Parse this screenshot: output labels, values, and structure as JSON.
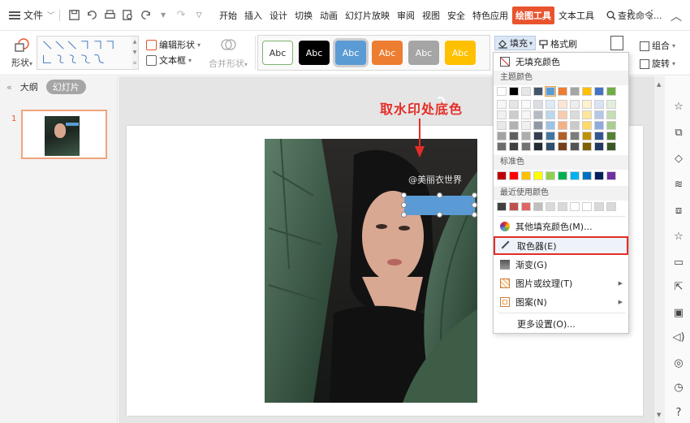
{
  "menubar": {
    "file_label": "文件",
    "tabs": [
      {
        "label": "开始"
      },
      {
        "label": "插入"
      },
      {
        "label": "设计"
      },
      {
        "label": "切换"
      },
      {
        "label": "动画"
      },
      {
        "label": "幻灯片放映"
      },
      {
        "label": "审阅"
      },
      {
        "label": "视图"
      },
      {
        "label": "安全"
      },
      {
        "label": "特色应用"
      },
      {
        "label": "绘图工具",
        "active": true
      },
      {
        "label": "文本工具"
      }
    ],
    "search_label": "查找命令...",
    "icons": [
      "save-icon",
      "undo-icon",
      "print-icon",
      "preview-icon",
      "redo-icon",
      "help-icon",
      "more-icon",
      "collapse-icon"
    ]
  },
  "ribbon": {
    "shape_label": "形状",
    "edit_shape_label": "编辑形状",
    "textbox_label": "文本框",
    "merge_shape_label": "合并形状",
    "style_samples": [
      "Abc",
      "Abc",
      "Abc",
      "Abc",
      "Abc",
      "Abc"
    ],
    "fill_label": "填充",
    "format_brush_label": "格式刷",
    "group_label": "组合",
    "rotate_label": "旋转"
  },
  "left_panel": {
    "outline_tab": "大纲",
    "slides_tab": "幻灯片",
    "slide_number": "1"
  },
  "canvas": {
    "annotation_text": "取水印处底色",
    "watermark_text": "@美丽衣世界"
  },
  "fill_menu": {
    "no_fill": "无填充颜色",
    "theme_colors_header": "主题颜色",
    "standard_colors_header": "标准色",
    "recent_colors_header": "最近使用颜色",
    "more_fill_colors": "其他填充颜色(M)...",
    "eyedropper": "取色器(E)",
    "gradient": "渐变(G)",
    "picture_texture": "图片或纹理(T)",
    "pattern": "图案(N)",
    "more_settings": "更多设置(O)...",
    "theme_top_row": [
      "#ffffff",
      "#000000",
      "#e7e6e6",
      "#44546a",
      "#5b9bd5",
      "#ed7d31",
      "#a5a5a5",
      "#ffc000",
      "#4472c4",
      "#70ad47"
    ],
    "standard_colors": [
      "#c00000",
      "#ff0000",
      "#ffc000",
      "#ffff00",
      "#92d050",
      "#00b050",
      "#00b0f0",
      "#0070c0",
      "#002060",
      "#7030a0"
    ],
    "recent_colors": [
      "#404040",
      "#c0504d",
      "#e06666",
      "#bfbfbf",
      "#d9d9d9",
      "#d9d9d9",
      "#ffffff",
      "#ffffff",
      "#d9d9d9",
      "#d9d9d9"
    ]
  },
  "right_bar": {
    "icons": [
      "assist-icon",
      "layout-icon",
      "shape-icon",
      "settings-icon",
      "image-icon",
      "star-icon",
      "window-icon",
      "share-icon",
      "picture-icon",
      "audio-icon",
      "history-icon",
      "clock-icon",
      "help-icon"
    ]
  }
}
